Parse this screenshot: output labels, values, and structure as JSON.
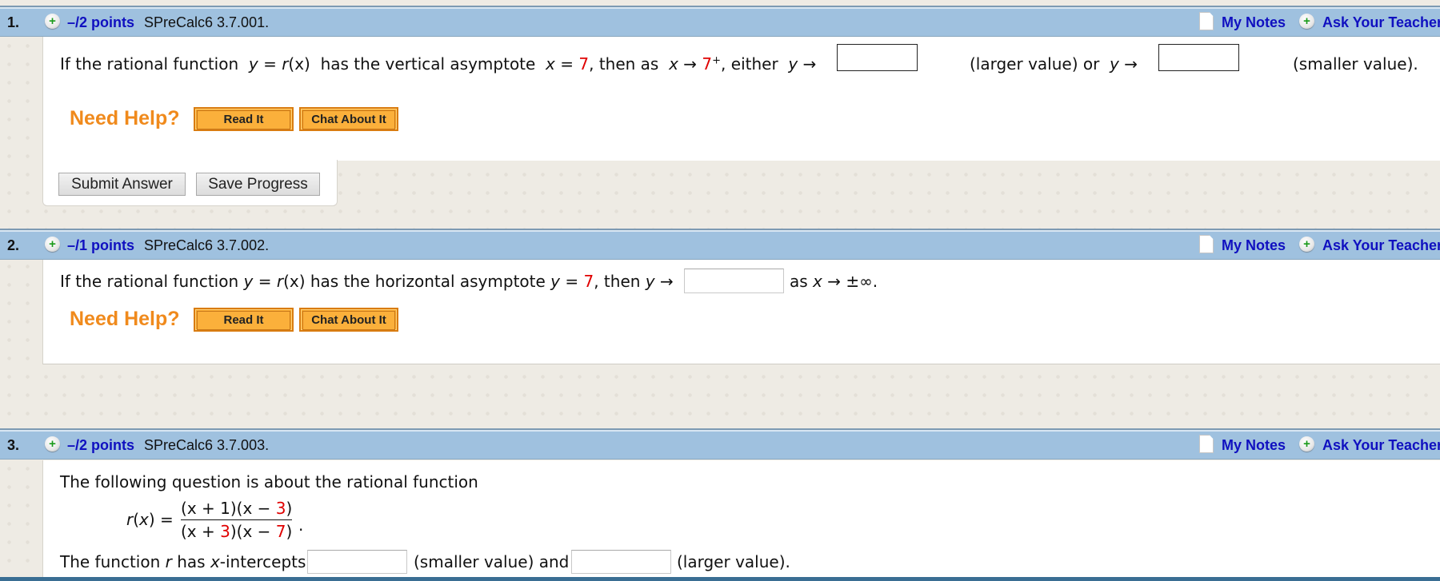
{
  "questions": [
    {
      "number": "1.",
      "points": "–/2 points",
      "code": "SPreCalc6 3.7.001.",
      "my_notes": "My Notes",
      "ask_teacher": "Ask Your Teacher",
      "text": {
        "p1": "If the rational function",
        "y": "y",
        "eq": "=",
        "r": "r",
        "x_paren": "(x)",
        "p2": "has the vertical asymptote",
        "x": "x",
        "eq2": "=",
        "val": "7",
        "p3": ", then as",
        "x2": "x",
        "arrow": "→",
        "val2": "7",
        "sup": "+",
        "p4": ", either",
        "y2": "y",
        "arrow2": "→",
        "larger": "(larger value)  or",
        "y3": "y",
        "arrow3": "→",
        "smaller": "(smaller value)."
      },
      "answers": [
        "",
        ""
      ],
      "need_help": "Need Help?",
      "read_it": "Read It",
      "chat_about_it": "Chat About It",
      "submit_answer": "Submit Answer",
      "save_progress": "Save Progress"
    },
    {
      "number": "2.",
      "points": "–/1 points",
      "code": "SPreCalc6 3.7.002.",
      "my_notes": "My Notes",
      "ask_teacher": "Ask Your Teacher",
      "text": {
        "p1": "If the rational function",
        "y": "y",
        "eq": "=",
        "r": "r",
        "x_paren": "(x)",
        "p2": "has the horizontal asymptote",
        "y2": "y",
        "eq2": "=",
        "val": "7",
        "p3": ", then",
        "y3": "y",
        "arrow": "→",
        "p4": "as",
        "x": "x",
        "arrow2": "→",
        "pm_inf": "±∞."
      },
      "answers": [
        ""
      ],
      "need_help": "Need Help?",
      "read_it": "Read It",
      "chat_about_it": "Chat About It"
    },
    {
      "number": "3.",
      "points": "–/2 points",
      "code": "SPreCalc6 3.7.003.",
      "my_notes": "My Notes",
      "ask_teacher": "Ask Your Teacher",
      "text": {
        "intro": "The following question is about the rational function",
        "lhs": "r(x) =",
        "num_a": "(x + 1)(x − ",
        "num_b": "3",
        "num_c": ")",
        "den_a": "(x + ",
        "den_b": "3",
        "den_c": ")(x − ",
        "den_d": "7",
        "den_e": ")",
        "period": ".",
        "p1": "The function",
        "r": "r",
        "p2": "has",
        "x": "x",
        "p3": "-intercepts",
        "smaller": "(smaller value) and",
        "larger": "(larger value)."
      },
      "answers": [
        "",
        ""
      ]
    }
  ],
  "colors": {
    "header_bg": "#9fc1df",
    "link_blue": "#1010c0",
    "need_help_orange": "#f08a1c",
    "highlight_red": "#e00000"
  }
}
